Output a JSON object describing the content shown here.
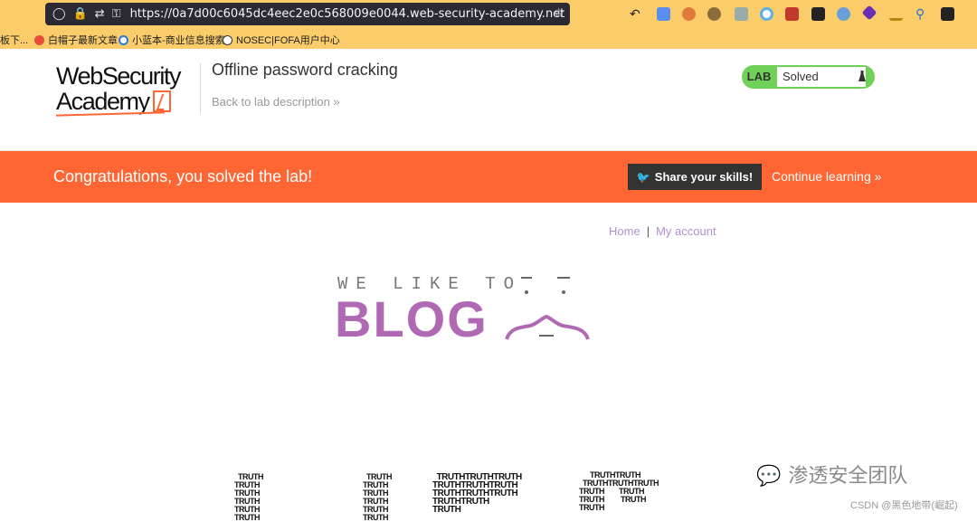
{
  "browser": {
    "url": "https://0a7d00c6045dc4eec2e0c568009e0044.web-security-academy.net",
    "bookmarks": [
      "板下...",
      "白帽子最新文章",
      "小蓝本-商业信息搜索",
      "NOSEC|FOFA用户中心"
    ]
  },
  "header": {
    "logo_line1": "WebSecurity",
    "logo_line2": "Academy",
    "lab_title": "Offline password cracking",
    "back_link": "Back to lab description »",
    "badge_label": "LAB",
    "badge_status": "Solved"
  },
  "banner": {
    "message": "Congratulations, you solved the lab!",
    "share_label": "Share your skills!",
    "continue_label": "Continue learning »"
  },
  "nav": {
    "home": "Home",
    "separator": "|",
    "account": "My account"
  },
  "blog_logo": {
    "tagline": "WE LIKE TO",
    "word": "BLOG"
  },
  "hero_word": "TRUTH",
  "watermark": {
    "name": "渗透安全团队",
    "credit": "CSDN @黑色地带(崛起)"
  },
  "colors": {
    "accent_orange": "#ff6633",
    "blog_purple": "#b06ab3",
    "solved_green": "#70d158",
    "chrome_yellow": "#fbcc6a"
  }
}
